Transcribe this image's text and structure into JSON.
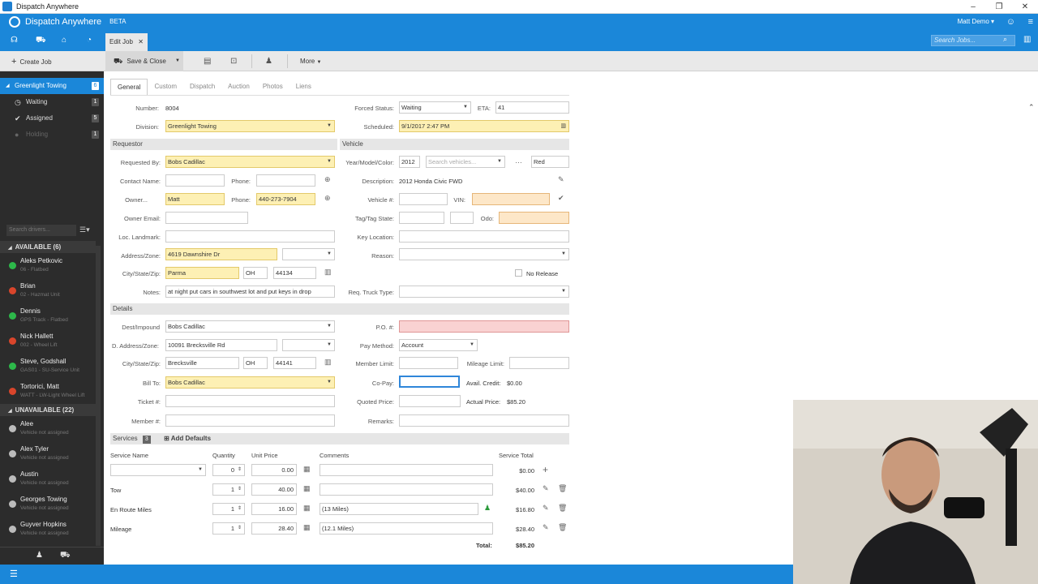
{
  "window": {
    "title": "Dispatch Anywhere",
    "controls": [
      "–",
      "❐",
      "✕"
    ]
  },
  "app": {
    "brand": "Dispatch Anywhere",
    "beta": "BETA",
    "user": "Matt Demo ▾"
  },
  "nav": {
    "tab_label": "Edit Job",
    "search_placeholder": "Search Jobs..."
  },
  "toolbar": {
    "create_job": "Create Job",
    "save_close": "Save & Close",
    "more": "More"
  },
  "sidebar": {
    "groups": [
      {
        "label": "Greenlight Towing",
        "count": "6",
        "active": true
      },
      {
        "label": "Waiting",
        "count": "1"
      },
      {
        "label": "Assigned",
        "count": "5"
      },
      {
        "label": "Holding",
        "count": "1",
        "disabled": true
      }
    ],
    "filter_placeholder": "Search drivers...",
    "available_label": "AVAILABLE (6)",
    "unavailable_label": "UNAVAILABLE (22)",
    "available": [
      {
        "name": "Aleks Petkovic",
        "sub": "06 - Flatbed",
        "color": "#2db84a"
      },
      {
        "name": "Brian",
        "sub": "02 - Hazmat Unit",
        "color": "#d9452b"
      },
      {
        "name": "Dennis",
        "sub": "GPS Track - Flatbed",
        "color": "#2db84a"
      },
      {
        "name": "Nick Hallett",
        "sub": "002 - Wheel Lift",
        "color": "#d9452b"
      },
      {
        "name": "Steve, Godshall",
        "sub": "GAS01 - SU-Service Unit",
        "color": "#2db84a"
      },
      {
        "name": "Tortorici, Matt",
        "sub": "WATT - LW-Light Wheel Lift",
        "color": "#d9452b"
      }
    ],
    "unavailable": [
      {
        "name": "Alee",
        "sub": "Vehicle not assigned"
      },
      {
        "name": "Alex Tyler",
        "sub": "Vehicle not assigned"
      },
      {
        "name": "Austin",
        "sub": "Vehicle not assigned"
      },
      {
        "name": "Georges Towing",
        "sub": "Vehicle not assigned"
      },
      {
        "name": "Guyver Hopkins",
        "sub": "Vehicle not assigned"
      }
    ]
  },
  "form_tabs": [
    "General",
    "Custom",
    "Dispatch",
    "Auction",
    "Photos",
    "Liens"
  ],
  "job": {
    "number_label": "Number:",
    "number": "8004",
    "division_label": "Division:",
    "division": "Greenlight Towing",
    "forced_status_label": "Forced Status:",
    "forced_status": "Waiting",
    "eta_label": "ETA:",
    "eta": "41",
    "scheduled_label": "Scheduled:",
    "scheduled": "9/1/2017 2:47 PM"
  },
  "requestor": {
    "section": "Requestor",
    "requested_by_label": "Requested By:",
    "requested_by": "Bobs Cadillac",
    "contact_name_label": "Contact Name:",
    "phone_label": "Phone:",
    "owner_label": "Owner...",
    "owner": "Matt",
    "owner_phone": "440-273-7904",
    "owner_email_label": "Owner Email:",
    "loc_landmark_label": "Loc. Landmark:",
    "address_label": "Address/Zone:",
    "address": "4619 Dawnshire Dr",
    "city_label": "City/State/Zip:",
    "city": "Parma",
    "state": "OH",
    "zip": "44134",
    "notes_label": "Notes:",
    "notes": "at night put cars in southwest lot and put keys in drop"
  },
  "vehicle": {
    "section": "Vehicle",
    "ymc_label": "Year/Model/Color:",
    "year": "2012",
    "search_placeholder": "Search vehicles...",
    "color": "Red",
    "description_label": "Description:",
    "description": "2012 Honda Civic FWD",
    "vehicle_num_label": "Vehicle #:",
    "vin_label": "VIN:",
    "tag_label": "Tag/Tag State:",
    "odo_label": "Odo:",
    "key_location_label": "Key Location:",
    "reason_label": "Reason:",
    "no_release_label": "No Release",
    "req_truck_label": "Req. Truck Type:"
  },
  "details": {
    "section": "Details",
    "dest_label": "Dest/Impound",
    "dest": "Bobs Cadillac",
    "d_address_label": "D. Address/Zone:",
    "d_address": "10091 Brecksville Rd",
    "city_label": "City/State/Zip:",
    "city": "Brecksville",
    "state": "OH",
    "zip": "44141",
    "bill_to_label": "Bill To:",
    "bill_to": "Bobs Cadillac",
    "ticket_label": "Ticket #:",
    "member_label": "Member #:",
    "po_label": "P.O. #:",
    "pay_method_label": "Pay Method:",
    "pay_method": "Account",
    "member_limit_label": "Member Limit:",
    "mileage_limit_label": "Mileage Limit:",
    "copay_label": "Co-Pay:",
    "avail_credit_label": "Avail. Credit:",
    "avail_credit": "$0.00",
    "quoted_label": "Quoted Price:",
    "actual_label": "Actual Price:",
    "actual": "$85.20",
    "remarks_label": "Remarks:"
  },
  "services": {
    "section": "Services",
    "count": "3",
    "add_defaults": "Add Defaults",
    "headers": {
      "name": "Service Name",
      "qty": "Quantity",
      "price": "Unit Price",
      "comments": "Comments",
      "total": "Service Total"
    },
    "rows": [
      {
        "name": "",
        "qty": "0",
        "price": "0.00",
        "comment": "",
        "total": "$0.00"
      },
      {
        "name": "Tow",
        "qty": "1",
        "price": "40.00",
        "comment": "",
        "total": "$40.00"
      },
      {
        "name": "En Route Miles",
        "qty": "1",
        "price": "16.00",
        "comment": "(13 Miles)",
        "total": "$16.80"
      },
      {
        "name": "Mileage",
        "qty": "1",
        "price": "28.40",
        "comment": "(12.1 Miles)",
        "total": "$28.40"
      }
    ],
    "total_label": "Total:",
    "total": "$85.20"
  }
}
